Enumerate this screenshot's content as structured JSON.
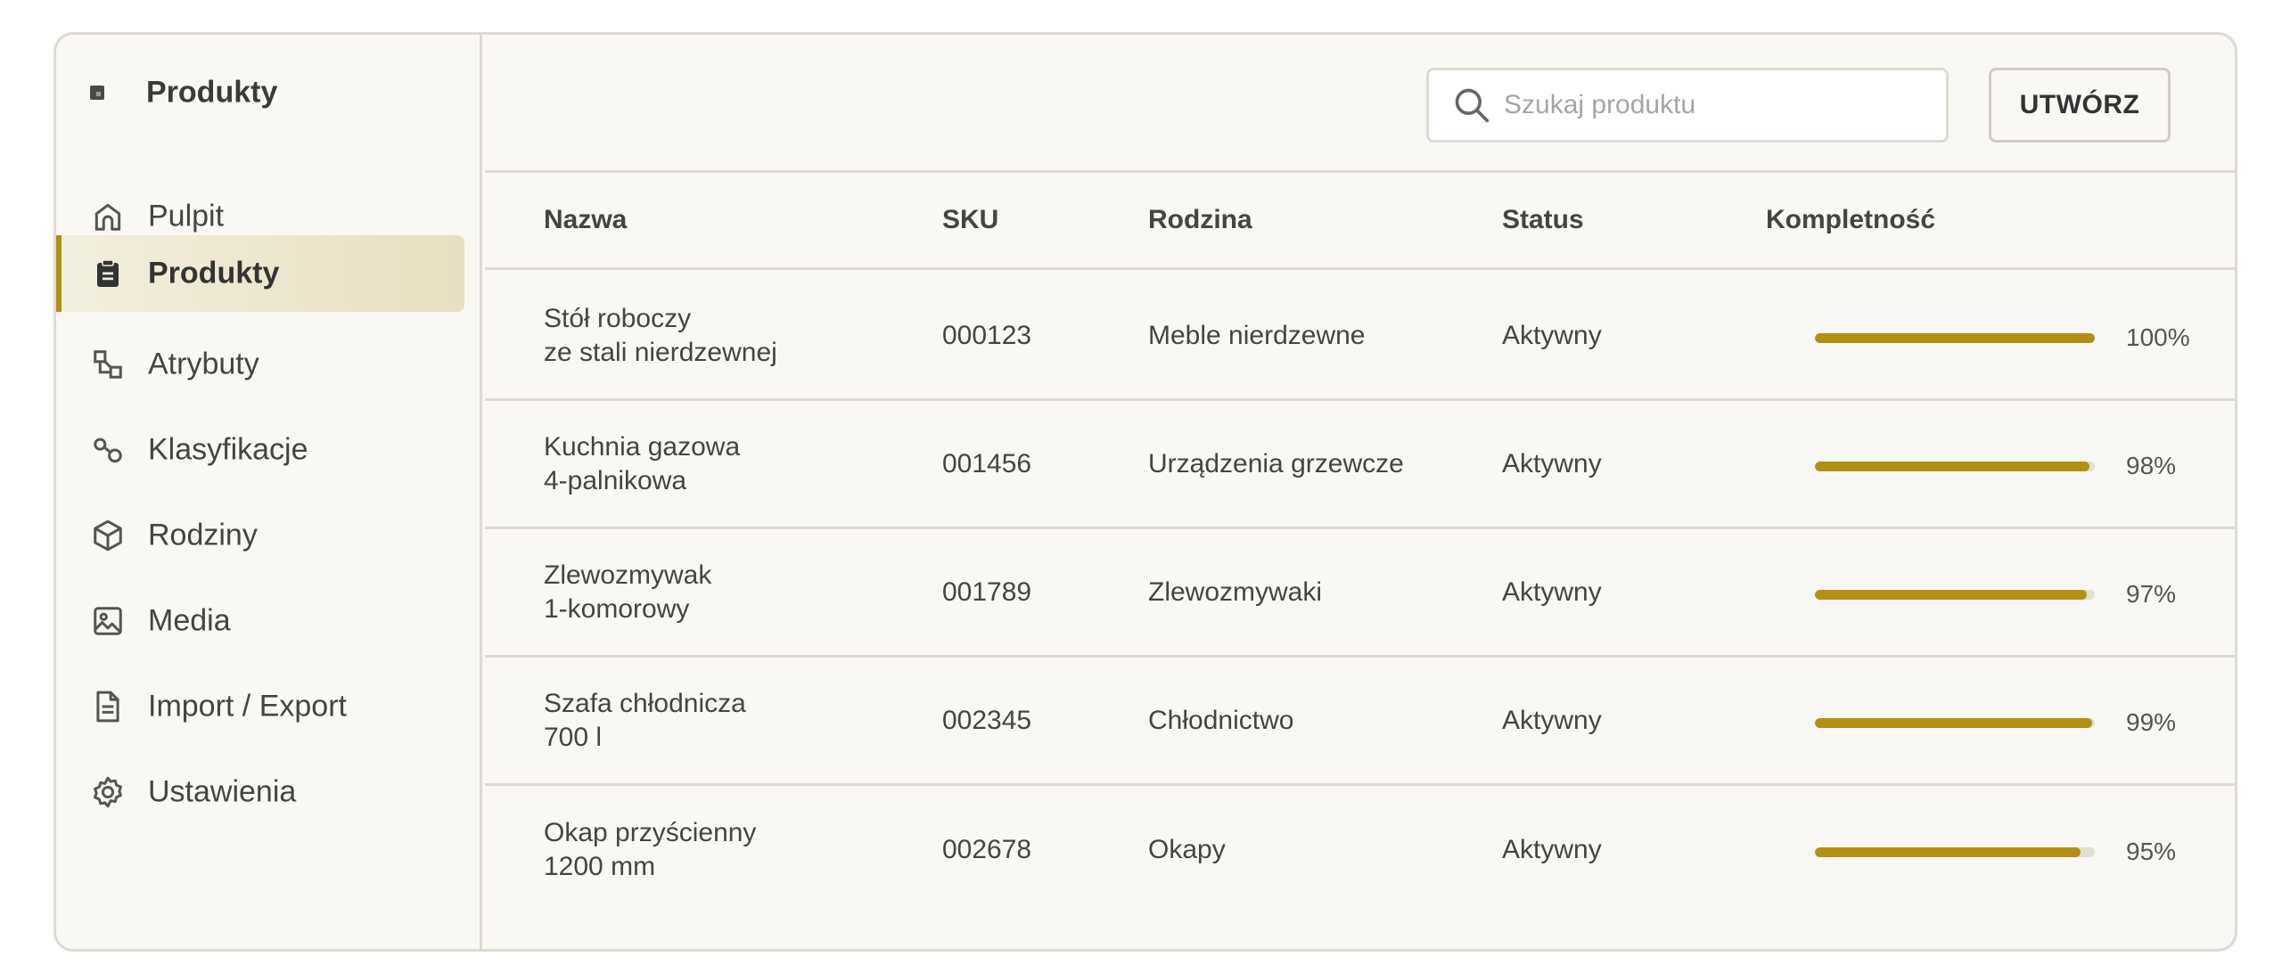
{
  "colors": {
    "accent": "#b38f13",
    "active_bg": "#e8dfc0",
    "panel_bg": "#f9f8f4",
    "border": "#dcdad2"
  },
  "sidebar": {
    "title": "Produkty",
    "title_icon": "logo-square-icon",
    "items": [
      {
        "label": "Pulpit",
        "icon": "home-icon",
        "active": false
      },
      {
        "label": "Produkty",
        "icon": "clipboard-icon",
        "active": true
      },
      {
        "label": "Atrybuty",
        "icon": "attributes-icon",
        "active": false
      },
      {
        "label": "Klasyfikacje",
        "icon": "classification-icon",
        "active": false
      },
      {
        "label": "Rodziny",
        "icon": "cube-icon",
        "active": false
      },
      {
        "label": "Media",
        "icon": "image-icon",
        "active": false
      },
      {
        "label": "Import / Export",
        "icon": "document-icon",
        "active": false
      },
      {
        "label": "Ustawienia",
        "icon": "gear-icon",
        "active": false
      }
    ]
  },
  "toolbar": {
    "search_placeholder": "Szukaj produktu",
    "search_value": "",
    "create_label": "UTWÓRZ"
  },
  "table": {
    "columns": {
      "name": "Nazwa",
      "sku": "SKU",
      "family": "Rodzina",
      "status": "Status",
      "completeness": "Kompletność"
    },
    "rows": [
      {
        "name": "Stół roboczy\nze stali nierdzewnej",
        "sku": "000123",
        "family": "Meble nierdzewne",
        "status": "Aktywny",
        "completeness": 100,
        "completeness_label": "100%"
      },
      {
        "name": "Kuchnia gazowa\n4-palnikowa",
        "sku": "001456",
        "family": "Urządzenia grzewcze",
        "status": "Aktywny",
        "completeness": 98,
        "completeness_label": "98%"
      },
      {
        "name": "Zlewozmywak\n1-komorowy",
        "sku": "001789",
        "family": "Zlewozmywaki",
        "status": "Aktywny",
        "completeness": 97,
        "completeness_label": "97%"
      },
      {
        "name": "Szafa chłodnicza\n700 l",
        "sku": "002345",
        "family": "Chłodnictwo",
        "status": "Aktywny",
        "completeness": 99,
        "completeness_label": "99%"
      },
      {
        "name": "Okap przyścienny\n1200 mm",
        "sku": "002678",
        "family": "Okapy",
        "status": "Aktywny",
        "completeness": 95,
        "completeness_label": "95%"
      }
    ]
  }
}
